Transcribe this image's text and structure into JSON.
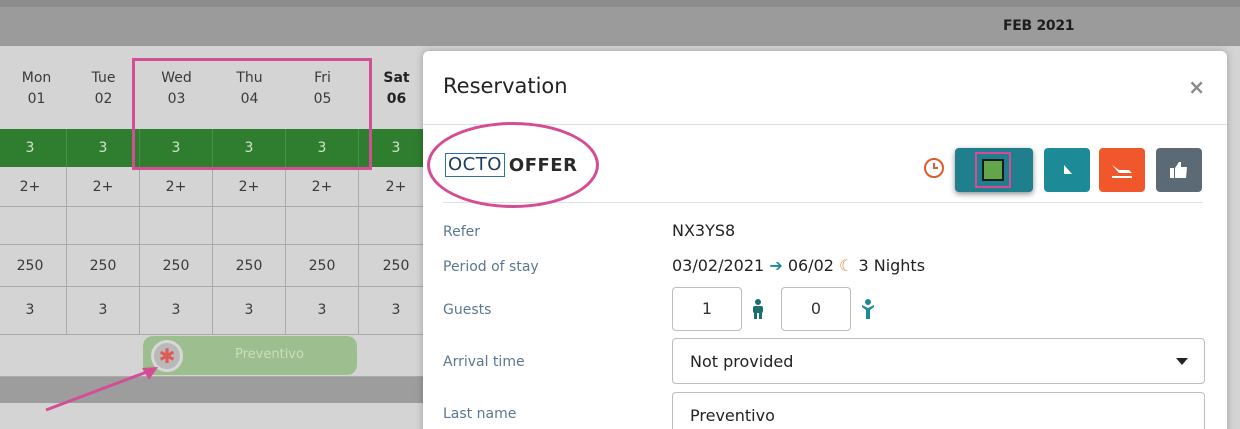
{
  "calendar": {
    "month": "FEB 2021",
    "days": [
      {
        "name": "Mon",
        "num": "01",
        "weekend": false
      },
      {
        "name": "Tue",
        "num": "02",
        "weekend": false
      },
      {
        "name": "Wed",
        "num": "03",
        "weekend": false
      },
      {
        "name": "Thu",
        "num": "04",
        "weekend": false
      },
      {
        "name": "Fri",
        "num": "05",
        "weekend": false
      },
      {
        "name": "Sat",
        "num": "06",
        "weekend": true
      }
    ],
    "availability": [
      "3",
      "3",
      "3",
      "3",
      "3",
      "3"
    ],
    "occupancy": [
      "2+",
      "2+",
      "2+",
      "2+",
      "2+",
      "2+"
    ],
    "prices": [
      "250",
      "250",
      "250",
      "250",
      "250",
      "250"
    ],
    "min_stay": [
      "3",
      "3",
      "3",
      "3",
      "3",
      "3"
    ],
    "booking": {
      "label": "Preventivo",
      "icon": "asterisk-icon"
    }
  },
  "modal": {
    "title": "Reservation",
    "close": "×",
    "brand": {
      "box_text": "OCTO",
      "text": "OFFER"
    },
    "actions": [
      {
        "name": "status-button",
        "icon": "square-icon",
        "color": "#1f7f8c"
      },
      {
        "name": "checkin-button",
        "icon": "checkin-icon",
        "color": "#1c8a97"
      },
      {
        "name": "checkout-button",
        "icon": "plane-departure-icon",
        "color": "#f0572a"
      },
      {
        "name": "confirm-button",
        "icon": "thumbs-up-icon",
        "color": "#5c6a75"
      }
    ],
    "fields": {
      "refer_label": "Refer",
      "refer_value": "NX3YS8",
      "period_label": "Period of stay",
      "period_from": "03/02/2021",
      "period_to": "06/02",
      "nights": "3 Nights",
      "guests_label": "Guests",
      "adults": "1",
      "children": "0",
      "arrival_label": "Arrival time",
      "arrival_value": "Not provided",
      "lastname_label": "Last name",
      "lastname_value": "Preventivo"
    }
  }
}
